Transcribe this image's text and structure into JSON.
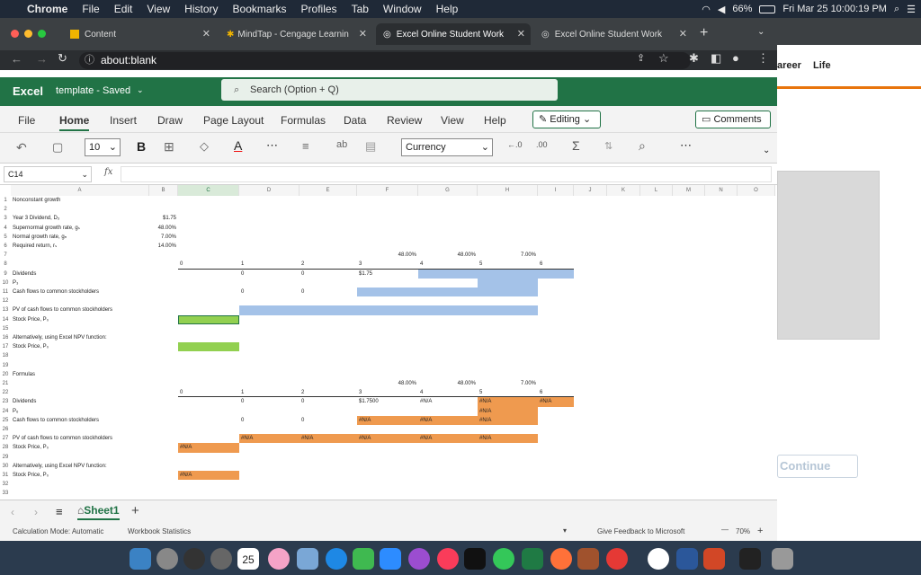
{
  "menubar": {
    "app": "Chrome",
    "items": [
      "File",
      "Edit",
      "View",
      "History",
      "Bookmarks",
      "Profiles",
      "Tab",
      "Window",
      "Help"
    ],
    "battery": "66%",
    "datetime": "Fri Mar 25  10:00:19 PM"
  },
  "tabs": [
    {
      "label": "Content"
    },
    {
      "label": "MindTap - Cengage Learnin"
    },
    {
      "label": "Excel Online Student Work"
    },
    {
      "label": "Excel Online Student Work"
    }
  ],
  "url": "about:blank",
  "excel": {
    "logo": "Excel",
    "doc": "template - Saved",
    "search": "Search (Option + Q)"
  },
  "ribbon": {
    "tabs": [
      "File",
      "Home",
      "Insert",
      "Draw",
      "Page Layout",
      "Formulas",
      "Data",
      "Review",
      "View",
      "Help"
    ],
    "editing": "Editing",
    "comments": "Comments"
  },
  "toolbar": {
    "font_size": "10",
    "number_format": "Currency"
  },
  "formula": {
    "namebox": "C14",
    "fx": "fx"
  },
  "columns": [
    "A",
    "B",
    "C",
    "D",
    "E",
    "F",
    "G",
    "H",
    "I",
    "J",
    "K",
    "L",
    "M",
    "N",
    "O"
  ],
  "sheet": {
    "a": {
      "1": "Nonconstant growth",
      "3": "Year 3 Dividend, D₃",
      "4": "Supernormal growth rate, gₛ",
      "5": "Normal growth rate, gₙ",
      "6": "Required return, rₛ",
      "9": "Dividends",
      "10": "P₃",
      "11": "Cash flows to common stockholders",
      "13": "PV of cash flows to common stockholders",
      "14": "Stock Price, P₀",
      "16": "Alternatively, using Excel NPV function:",
      "17": "Stock Price, P₀",
      "20": "Formulas",
      "23": "Dividends",
      "24": "P₆",
      "25": "Cash flows to common stockholders",
      "27": "PV of cash flows to common stockholders",
      "28": "Stock Price, P₀",
      "30": "Alternatively, using Excel NPV function:",
      "31": "Stock Price, P₀"
    },
    "b": {
      "3": "$1.75",
      "4": "48.00%",
      "5": "7.00%",
      "6": "14.00%"
    },
    "r7": {
      "f": "48.00%",
      "g": "48.00%",
      "h": "7.00%"
    },
    "r8": {
      "c": "0",
      "d": "1",
      "e": "2",
      "f": "3",
      "g": "4",
      "h": "5",
      "i": "6"
    },
    "r9": {
      "d": "0",
      "e": "0",
      "f": "$1.75"
    },
    "r11": {
      "d": "0",
      "e": "0"
    },
    "r21": {
      "f": "48.00%",
      "g": "48.00%",
      "h": "7.00%"
    },
    "r22": {
      "c": "0",
      "d": "1",
      "e": "2",
      "f": "3",
      "g": "4",
      "h": "5",
      "i": "6"
    },
    "r23": {
      "d": "0",
      "e": "0",
      "f": "$1.7500",
      "g": "#N/A",
      "h": "#N/A",
      "i": "#N/A"
    },
    "r24": {
      "h": "#N/A"
    },
    "r25": {
      "d": "0",
      "e": "0",
      "f": "#N/A",
      "g": "#N/A",
      "h": "#N/A"
    },
    "r27": {
      "d": "#N/A",
      "e": "#N/A",
      "f": "#N/A",
      "g": "#N/A",
      "h": "#N/A"
    },
    "r28": {
      "c": "#N/A"
    },
    "r31": {
      "c": "#N/A"
    }
  },
  "sheettab": "Sheet1",
  "status": {
    "mode": "Calculation Mode: Automatic",
    "stats": "Workbook Statistics",
    "feedback": "Give Feedback to Microsoft",
    "zoom": "70%"
  },
  "rightpanel": {
    "career": "areer",
    "life": "Life",
    "continue": "Continue"
  },
  "dock": {
    "calendar": "25"
  }
}
